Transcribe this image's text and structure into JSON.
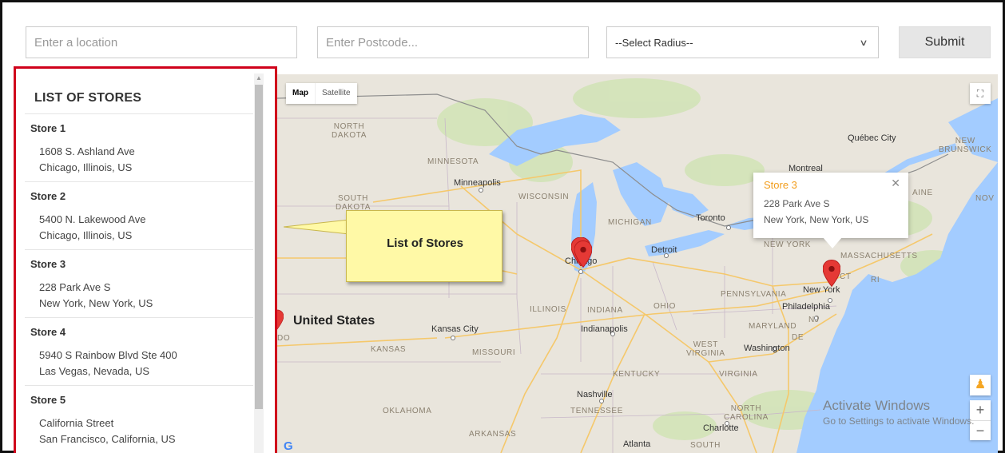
{
  "search": {
    "location_placeholder": "Enter a location",
    "postcode_placeholder": "Enter Postcode...",
    "radius_selected": "--Select Radius--",
    "submit_label": "Submit"
  },
  "store_list": {
    "title": "LIST OF STORES",
    "stores": [
      {
        "name": "Store 1",
        "address": "1608 S. Ashland Ave",
        "city": "Chicago, Illinois, US"
      },
      {
        "name": "Store 2",
        "address": "5400 N. Lakewood Ave",
        "city": "Chicago, Illinois, US"
      },
      {
        "name": "Store 3",
        "address": "228 Park Ave S",
        "city": "New York, New York, US"
      },
      {
        "name": "Store 4",
        "address": "5940 S Rainbow Blvd Ste 400",
        "city": "Las Vegas, Nevada, US"
      },
      {
        "name": "Store 5",
        "address": "California Street",
        "city": "San Francisco, California, US"
      }
    ]
  },
  "callout": {
    "text": "List of Stores"
  },
  "map": {
    "type_map": "Map",
    "type_satellite": "Satellite",
    "labels": {
      "north_dakota": "NORTH\nDAKOTA",
      "south_dakota": "SOUTH\nDAKOTA",
      "minnesota": "MINNESOTA",
      "minneapolis": "Minneapolis",
      "wisconsin": "WISCONSIN",
      "michigan": "MICHIGAN",
      "toronto": "Toronto",
      "quebec_city": "Québec City",
      "new_brunswick": "NEW\nBRUNSWICK",
      "montreal": "Montreal",
      "maine": "AINE",
      "nov": "NOV",
      "detroit": "Detroit",
      "chicago": "Chicago",
      "new_york_state": "NEW YORK",
      "massachusetts": "MASSACHUSETTS",
      "ct": "CT",
      "ri": "RI",
      "new_york_city": "New York",
      "pennsylvania": "PENNSYLVANIA",
      "philadelphia": "Philadelphia",
      "nj": "NJ",
      "maryland": "MARYLAND",
      "de": "DE",
      "washington": "Washington",
      "ohio": "OHIO",
      "indiana": "INDIANA",
      "illinois": "ILLINOIS",
      "indianapolis": "Indianapolis",
      "kansas_city": "Kansas City",
      "kansas": "KANSAS",
      "missouri": "MISSOURI",
      "united_states": "United States",
      "west_virginia": "WEST\nVIRGINIA",
      "virginia": "VIRGINIA",
      "kentucky": "KENTUCKY",
      "nashville": "Nashville",
      "tennessee": "TENNESSEE",
      "oklahoma": "OKLAHOMA",
      "arkansas": "ARKANSAS",
      "north_carolina": "NORTH\nCAROLINA",
      "charlotte": "Charlotte",
      "atlanta": "Atlanta",
      "south": "SOUTH",
      "nebraska_partial": "N",
      "do": "DO"
    },
    "info_window": {
      "title": "Store 3",
      "address": "228 Park Ave S",
      "city": "New York, New York, US"
    }
  },
  "watermark": {
    "line1": "Activate Windows",
    "line2": "Go to Settings to activate Windows."
  },
  "colors": {
    "highlight_border": "#d0021b",
    "pin": "#e53935",
    "info_title": "#f29d1c",
    "callout_bg": "#fff9a6",
    "water": "#a3ccff",
    "land": "#e9e5dc"
  }
}
